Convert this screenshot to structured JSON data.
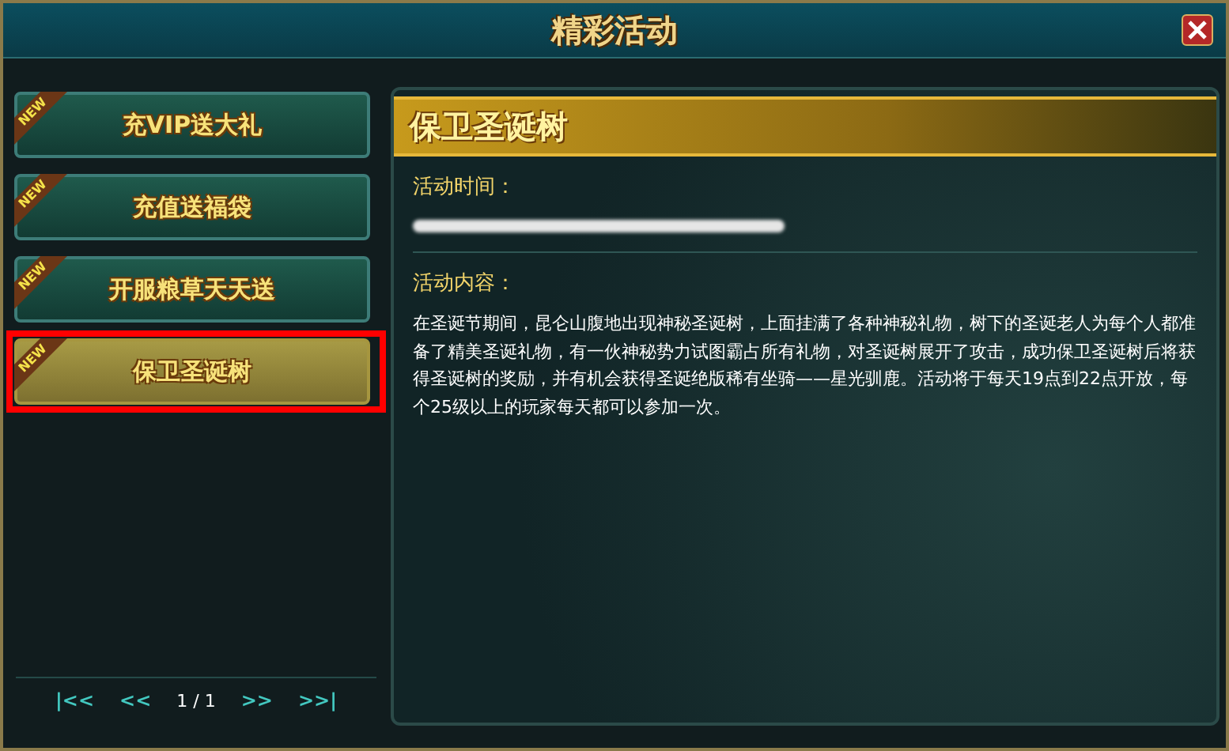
{
  "window": {
    "title": "精彩活动"
  },
  "activities": [
    {
      "label": "充VIP送大礼",
      "badge": "NEW",
      "selected": false,
      "highlighted": false
    },
    {
      "label": "充值送福袋",
      "badge": "NEW",
      "selected": false,
      "highlighted": false
    },
    {
      "label": "开服粮草天天送",
      "badge": "NEW",
      "selected": false,
      "highlighted": false
    },
    {
      "label": "保卫圣诞树",
      "badge": "NEW",
      "selected": true,
      "highlighted": true
    }
  ],
  "pager": {
    "first": "|<<",
    "prev": "<<",
    "page": "1 / 1",
    "next": ">>",
    "last": ">>|"
  },
  "detail": {
    "title": "保卫圣诞树",
    "time_label": "活动时间：",
    "time_redacted": true,
    "content_label": "活动内容：",
    "content": "在圣诞节期间，昆仑山腹地出现神秘圣诞树，上面挂满了各种神秘礼物，树下的圣诞老人为每个人都准备了精美圣诞礼物，有一伙神秘势力试图霸占所有礼物，对圣诞树展开了攻击，成功保卫圣诞树后将获得圣诞树的奖励，并有机会获得圣诞绝版稀有坐骑——星光驯鹿。活动将于每天19点到22点开放，每个25级以上的玩家每天都可以参加一次。"
  }
}
